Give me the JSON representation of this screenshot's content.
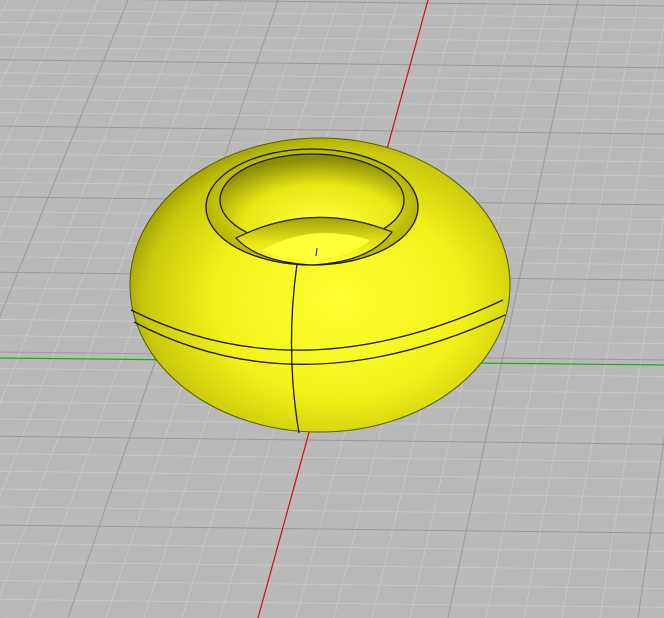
{
  "viewport": {
    "kind": "3d-cad-viewport",
    "object": "torus",
    "colors": {
      "background": "#b9b9b9",
      "grid_minor": "#cbcbcb",
      "grid_major": "#9a9a9a",
      "axis_x": "#d01010",
      "axis_y": "#10b010",
      "model_fill": "#ffff1a",
      "model_edge": "#1a1a00"
    },
    "grid_visible": true,
    "axes_visible": true
  }
}
